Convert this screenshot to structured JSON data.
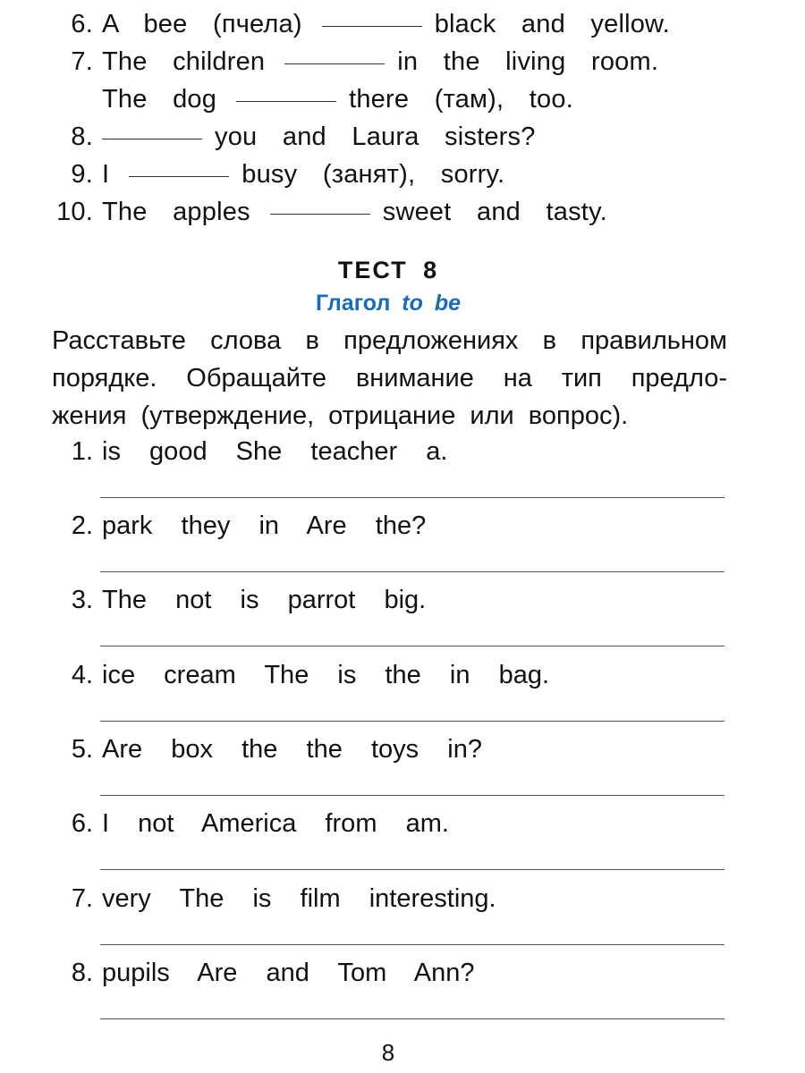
{
  "previous_exercise": {
    "items": [
      {
        "num": "6.",
        "before": "A  bee  (пчела)",
        "after": "black  and  yellow.",
        "has_blank": true
      },
      {
        "num": "7.",
        "before": "The  children",
        "after": "in  the  living  room.",
        "has_blank": true
      },
      {
        "num": "",
        "before": "The  dog",
        "after": "there  (там),  too.",
        "has_blank": true
      },
      {
        "num": "8.",
        "before": "",
        "after": "you  and  Laura  sisters?",
        "has_blank": true
      },
      {
        "num": "9.",
        "before": "I",
        "after": "busy  (занят),  sorry.",
        "has_blank": true
      },
      {
        "num": "10.",
        "before": "The  apples",
        "after": "sweet  and  tasty.",
        "has_blank": true
      }
    ]
  },
  "test": {
    "title": "ТЕСТ 8",
    "subtitle_prefix": "Глагол",
    "subtitle_italic": "to be",
    "subtitle_color": "#1a6bb8",
    "instruction_lines": [
      "Расставьте слова в предложениях в правильном",
      "порядке. Обращайте внимание на тип предло-",
      "жения (утверждение, отрицание или вопрос)."
    ],
    "items": [
      {
        "num": "1.",
        "words": "is  good  She  teacher  a."
      },
      {
        "num": "2.",
        "words": "park  they  in  Are  the?"
      },
      {
        "num": "3.",
        "words": "The  not  is  parrot  big."
      },
      {
        "num": "4.",
        "words": "ice  cream  The  is  the  in  bag."
      },
      {
        "num": "5.",
        "words": "Are  box  the  the  toys  in?"
      },
      {
        "num": "6.",
        "words": "I  not  America  from  am."
      },
      {
        "num": "7.",
        "words": "very  The  is  film  interesting."
      },
      {
        "num": "8.",
        "words": "pupils  Are  and  Tom  Ann?"
      }
    ]
  },
  "page_number": "8"
}
